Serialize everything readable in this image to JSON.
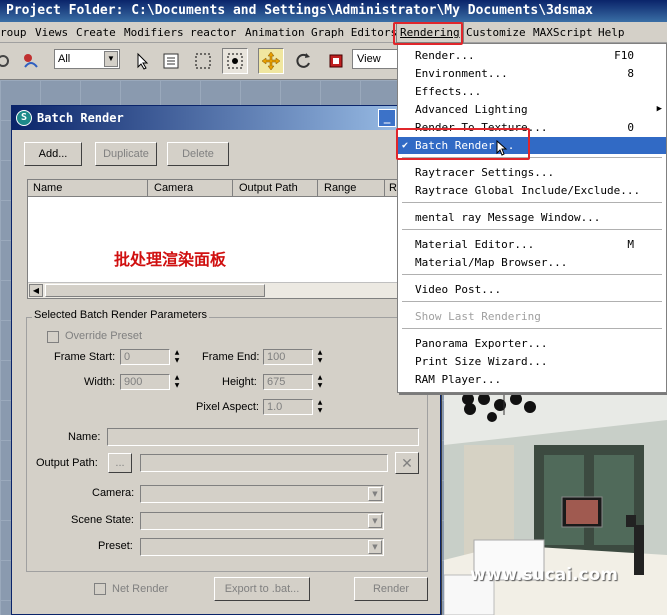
{
  "app": {
    "title": "Project Folder: C:\\Documents and Settings\\Administrator\\My Documents\\3dsmax"
  },
  "menubar": {
    "items": [
      "roup",
      "Views",
      "Create",
      "Modifiers",
      "reactor",
      "Animation",
      "Graph Editors",
      "Rendering",
      "Customize",
      "MAXScript",
      "Help"
    ],
    "active": "Rendering"
  },
  "toolbar": {
    "selection_filter": "All",
    "ref_coord": "View"
  },
  "rendering_menu": {
    "items": [
      {
        "label": "Render...",
        "shortcut": "F10"
      },
      {
        "label": "Environment...",
        "shortcut": "8"
      },
      {
        "label": "Effects...",
        "shortcut": ""
      },
      {
        "label": "Advanced Lighting",
        "shortcut": "▶"
      },
      {
        "label": "Render To Texture...",
        "shortcut": "0"
      },
      {
        "label": "Batch Render...",
        "shortcut": ""
      },
      {
        "label": "Raytracer Settings...",
        "shortcut": ""
      },
      {
        "label": "Raytrace Global Include/Exclude...",
        "shortcut": ""
      },
      {
        "label": "mental ray Message Window...",
        "shortcut": ""
      },
      {
        "label": "Material Editor...",
        "shortcut": "M"
      },
      {
        "label": "Material/Map Browser...",
        "shortcut": ""
      },
      {
        "label": "Video Post...",
        "shortcut": ""
      },
      {
        "label": "Show Last Rendering",
        "shortcut": ""
      },
      {
        "label": "Panorama Exporter...",
        "shortcut": ""
      },
      {
        "label": "Print Size Wizard...",
        "shortcut": ""
      },
      {
        "label": "RAM Player...",
        "shortcut": ""
      }
    ],
    "checked_item": "Batch Render...",
    "disabled_item": "Show Last Rendering"
  },
  "batch_render": {
    "title": "Batch Render",
    "buttons": {
      "add": "Add...",
      "duplicate": "Duplicate",
      "delete": "Delete"
    },
    "columns": [
      "Name",
      "Camera",
      "Output Path",
      "Range",
      "R"
    ],
    "annotation": "批处理渲染面板",
    "params_group": "Selected Batch Render Parameters",
    "override_preset": "Override Preset",
    "frame_start_label": "Frame Start:",
    "frame_start": "0",
    "frame_end_label": "Frame End:",
    "frame_end": "100",
    "width_label": "Width:",
    "width": "900",
    "height_label": "Height:",
    "height": "675",
    "pixel_aspect_label": "Pixel Aspect:",
    "pixel_aspect": "1.0",
    "name_label": "Name:",
    "output_path_label": "Output Path:",
    "browse": "...",
    "camera_label": "Camera:",
    "scene_state_label": "Scene State:",
    "preset_label": "Preset:",
    "net_render": "Net Render",
    "export_bat": "Export to .bat...",
    "render": "Render"
  },
  "watermark": "www.sucai.com",
  "colors": {
    "highlight": "#316ac5",
    "callout": "#e0262b",
    "annotation": "#d01010"
  }
}
